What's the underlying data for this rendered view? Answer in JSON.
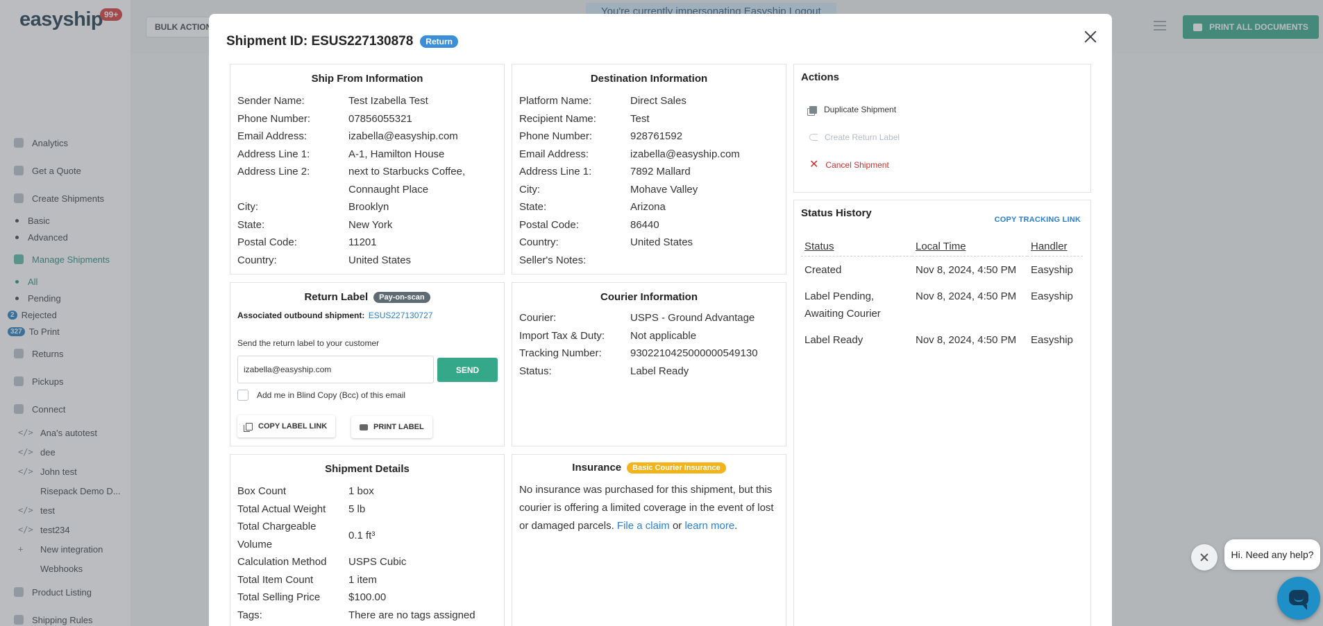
{
  "app": {
    "logo": "easyship",
    "notifications": "99+",
    "bulk_action": "BULK ACTION",
    "impersonation_notice": "You're currently impersonating Easyship",
    "logout": "Logout",
    "print_all": "PRINT ALL DOCUMENTS"
  },
  "sidebar": {
    "analytics": "Analytics",
    "quote": "Get a Quote",
    "create": "Create Shipments",
    "create_basic": "Basic",
    "create_advanced": "Advanced",
    "manage": "Manage Shipments",
    "manage_all": "All",
    "manage_pending": "Pending",
    "manage_rejected": "Rejected",
    "manage_rejected_count": "2",
    "manage_toprint": "To Print",
    "manage_toprint_count": "327",
    "returns": "Returns",
    "pickups": "Pickups",
    "connect": "Connect",
    "integrations": [
      {
        "code": "</>",
        "label": "Ana's autotest"
      },
      {
        "code": "</>",
        "label": "dee"
      },
      {
        "code": "</>",
        "label": "John test"
      },
      {
        "code": "",
        "label": "Risepack Demo D..."
      },
      {
        "code": "</>",
        "label": "test"
      },
      {
        "code": "</>",
        "label": "test234"
      },
      {
        "code": "+",
        "label": "New integration"
      },
      {
        "code": "",
        "label": "Webhooks"
      }
    ],
    "product_listing": "Product Listing",
    "shipping_rules": "Shipping Rules"
  },
  "modal": {
    "title": "Shipment ID: ESUS227130878",
    "tag": "Return"
  },
  "ship_from": {
    "title": "Ship From Information",
    "rows": [
      {
        "k": "Sender Name:",
        "v": "Test Izabella Test"
      },
      {
        "k": "Phone Number:",
        "v": "07856055321"
      },
      {
        "k": "Email Address:",
        "v": "izabella@easyship.com"
      },
      {
        "k": "Address Line 1:",
        "v": "A-1, Hamilton House"
      },
      {
        "k": "Address Line 2:",
        "v": "next to Starbucks Coffee, Connaught Place"
      },
      {
        "k": "City:",
        "v": "Brooklyn"
      },
      {
        "k": "State:",
        "v": "New York"
      },
      {
        "k": "Postal Code:",
        "v": "11201"
      },
      {
        "k": "Country:",
        "v": "United States"
      }
    ]
  },
  "destination": {
    "title": "Destination Information",
    "rows": [
      {
        "k": "Platform Name:",
        "v": "Direct Sales"
      },
      {
        "k": "Recipient Name:",
        "v": "Test"
      },
      {
        "k": "Phone Number:",
        "v": "928761592"
      },
      {
        "k": "Email Address:",
        "v": "izabella@easyship.com"
      },
      {
        "k": "Address Line 1:",
        "v": "7892 Mallard"
      },
      {
        "k": "City:",
        "v": "Mohave Valley"
      },
      {
        "k": "State:",
        "v": "Arizona"
      },
      {
        "k": "Postal Code:",
        "v": "86440"
      },
      {
        "k": "Country:",
        "v": "United States"
      },
      {
        "k": "Seller's Notes:",
        "v": ""
      }
    ]
  },
  "return_label": {
    "title": "Return Label",
    "tag": "Pay-on-scan",
    "assoc_label": "Associated outbound shipment:",
    "assoc_link": "ESUS227130727",
    "send_hint": "Send the return label to your customer",
    "email": "izabella@easyship.com",
    "send": "SEND",
    "bcc": "Add me in Blind Copy (Bcc) of this email",
    "copy_link": "COPY LABEL LINK",
    "print_label": "PRINT LABEL"
  },
  "courier": {
    "title": "Courier Information",
    "rows": [
      {
        "k": "Courier:",
        "v": "USPS - Ground Advantage"
      },
      {
        "k": "Import Tax & Duty:",
        "v": "Not applicable"
      },
      {
        "k": "Tracking Number:",
        "v": "9302210425000000549130"
      },
      {
        "k": "Status:",
        "v": "Label Ready"
      }
    ]
  },
  "shipment_details": {
    "title": "Shipment Details",
    "rows": [
      {
        "k": "Box Count",
        "v": "1 box"
      },
      {
        "k": "Total Actual Weight",
        "v": "5 lb"
      },
      {
        "k": "Total Chargeable Volume",
        "v": "0.1 ft³"
      },
      {
        "k": "Calculation Method",
        "v": "USPS Cubic"
      },
      {
        "k": "Total Item Count",
        "v": "1 item"
      },
      {
        "k": "Total Selling Price",
        "v": "$100.00"
      },
      {
        "k": "Tags:",
        "v": "There are no tags assigned"
      }
    ]
  },
  "insurance": {
    "title": "Insurance",
    "tag": "Basic Courier Insurance",
    "text": "No insurance was purchased for this shipment, but this courier is offering a limited coverage in the event of lost or damaged parcels.",
    "claim_link": "File a claim",
    "or": "or",
    "learn_link": "learn more",
    "period": "."
  },
  "actions": {
    "title": "Actions",
    "duplicate": "Duplicate Shipment",
    "create_return": "Create Return Label",
    "cancel": "Cancel Shipment"
  },
  "status_history": {
    "title": "Status History",
    "copy_link": "COPY TRACKING LINK",
    "headers": {
      "status": "Status",
      "time": "Local Time",
      "handler": "Handler"
    },
    "rows": [
      {
        "status": "Created",
        "time": "Nov 8, 2024, 4:50 PM",
        "handler": "Easyship"
      },
      {
        "status": "Label Pending, Awaiting Courier",
        "time": "Nov 8, 2024, 4:50 PM",
        "handler": "Easyship"
      },
      {
        "status": "Label Ready",
        "time": "Nov 8, 2024, 4:50 PM",
        "handler": "Easyship"
      }
    ]
  },
  "chat": {
    "greeting": "Hi. Need any help?"
  }
}
